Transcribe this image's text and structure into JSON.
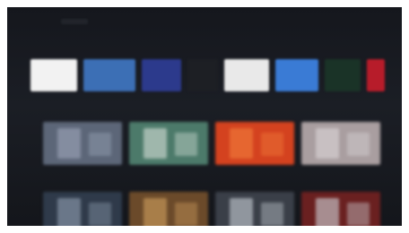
{
  "apps_row": {
    "items": [
      {
        "name": "app-tile-1",
        "color": "#f2f2f2",
        "width": 52
      },
      {
        "name": "app-tile-2",
        "color": "#3c6fb5",
        "width": 58
      },
      {
        "name": "app-tile-3",
        "color": "#2c3a8c",
        "width": 44
      },
      {
        "name": "app-tile-4",
        "color": "#1d1f24",
        "width": 34
      },
      {
        "name": "app-tile-5",
        "color": "#e9e9e9",
        "width": 50
      },
      {
        "name": "app-tile-6",
        "color": "#3a7bd5",
        "width": 48
      },
      {
        "name": "app-tile-7",
        "color": "#1a3327",
        "width": 40
      },
      {
        "name": "app-tile-8",
        "color": "#b71c2a",
        "width": 20
      }
    ]
  },
  "rows": [
    {
      "tiles": [
        {
          "bg": "#5c6678",
          "accent": "#9aa3b5"
        },
        {
          "bg": "#4c7a6a",
          "accent": "#cdd9d0"
        },
        {
          "bg": "#d4421f",
          "accent": "#f07a3a"
        },
        {
          "bg": "#a99ea0",
          "accent": "#d8d2d4"
        }
      ]
    },
    {
      "tiles": [
        {
          "bg": "#2f3a4a",
          "accent": "#8a98aa"
        },
        {
          "bg": "#6b4a2a",
          "accent": "#c99a5a"
        },
        {
          "bg": "#3a3f48",
          "accent": "#bfc5cc"
        },
        {
          "bg": "#6a2020",
          "accent": "#c8c8cc"
        }
      ]
    }
  ]
}
